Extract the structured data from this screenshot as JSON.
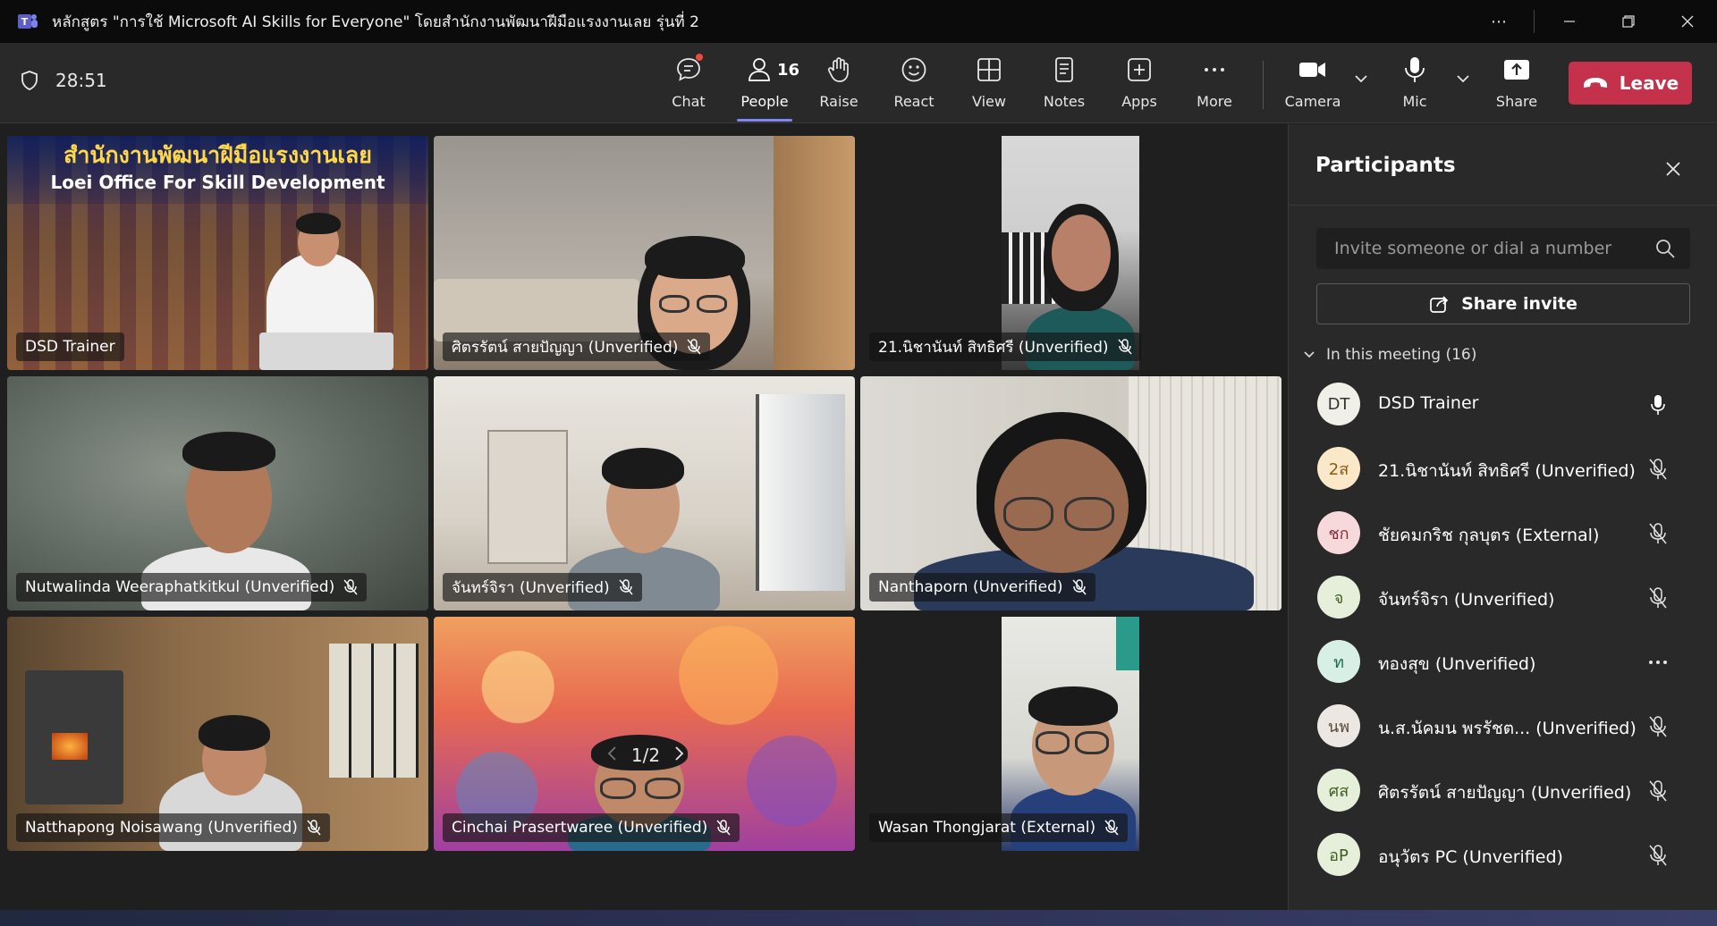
{
  "window": {
    "title": "หลักสูตร \"การใช้ Microsoft AI Skills for Everyone\" โดยสำนักงานพัฒนาฝีมือแรงงานเลย รุ่นที่ 2"
  },
  "toolbar": {
    "timer": "28:51",
    "chat_label": "Chat",
    "people_label": "People",
    "people_count": "16",
    "raise_label": "Raise",
    "react_label": "React",
    "view_label": "View",
    "notes_label": "Notes",
    "apps_label": "Apps",
    "more_label": "More",
    "camera_label": "Camera",
    "mic_label": "Mic",
    "share_label": "Share",
    "leave_label": "Leave"
  },
  "tiles": [
    {
      "name": "DSD Trainer",
      "banner_th": "สำนักงานพัฒนาฝีมือแรงงานเลย",
      "banner_en": "Loei Office For Skill Development"
    },
    {
      "name": "ศิตรรัตน์ สายปัญญา (Unverified)"
    },
    {
      "name": "21.นิชานันท์ สิทธิศรี (Unverified)"
    },
    {
      "name": "Nutwalinda Weeraphatkitkul (Unverified)"
    },
    {
      "name": "จันทร์จิรา (Unverified)"
    },
    {
      "name": "Nanthaporn (Unverified)"
    },
    {
      "name": "Natthapong Noisawang (Unverified)"
    },
    {
      "name": "Cinchai Prasertwaree (Unverified)"
    },
    {
      "name": "Wasan Thongjarat (External)"
    }
  ],
  "pager": {
    "text": "1/2"
  },
  "panel": {
    "title": "Participants",
    "invite_placeholder": "Invite someone or dial a number",
    "share_invite_label": "Share invite",
    "section_label": "In this meeting (16)",
    "participants": [
      {
        "initials": "DT",
        "name": "DSD Trainer",
        "bg": "#f0f0e8",
        "fg": "#333333"
      },
      {
        "initials": "2ส",
        "name": "21.นิชานันท์ สิทธิศรี (Unverified)",
        "bg": "#fbe8c8",
        "fg": "#8a5a10"
      },
      {
        "initials": "ชก",
        "name": "ชัยคมกริช กุลบุตร (External)",
        "bg": "#f7d9dc",
        "fg": "#8a2a35"
      },
      {
        "initials": "จ",
        "name": "จันทร์จิรา (Unverified)",
        "bg": "#e6efd9",
        "fg": "#3f5e22"
      },
      {
        "initials": "ท",
        "name": "ทองสุข (Unverified)",
        "bg": "#d8efe6",
        "fg": "#1f6b4f"
      },
      {
        "initials": "นพ",
        "name": "น.ส.นัคมน พรรัชต...  (Unverified)",
        "bg": "#ece7e2",
        "fg": "#5a4a3a"
      },
      {
        "initials": "ศส",
        "name": "ศิตรรัตน์ สายปัญญา (Unverified)",
        "bg": "#e6efd9",
        "fg": "#3f5e22"
      },
      {
        "initials": "อP",
        "name": "อนุวัตร PC (Unverified)",
        "bg": "#e6efd9",
        "fg": "#3f5e22"
      }
    ]
  },
  "colors": {
    "leave": "#c4314b",
    "accent": "#7f85f5"
  }
}
